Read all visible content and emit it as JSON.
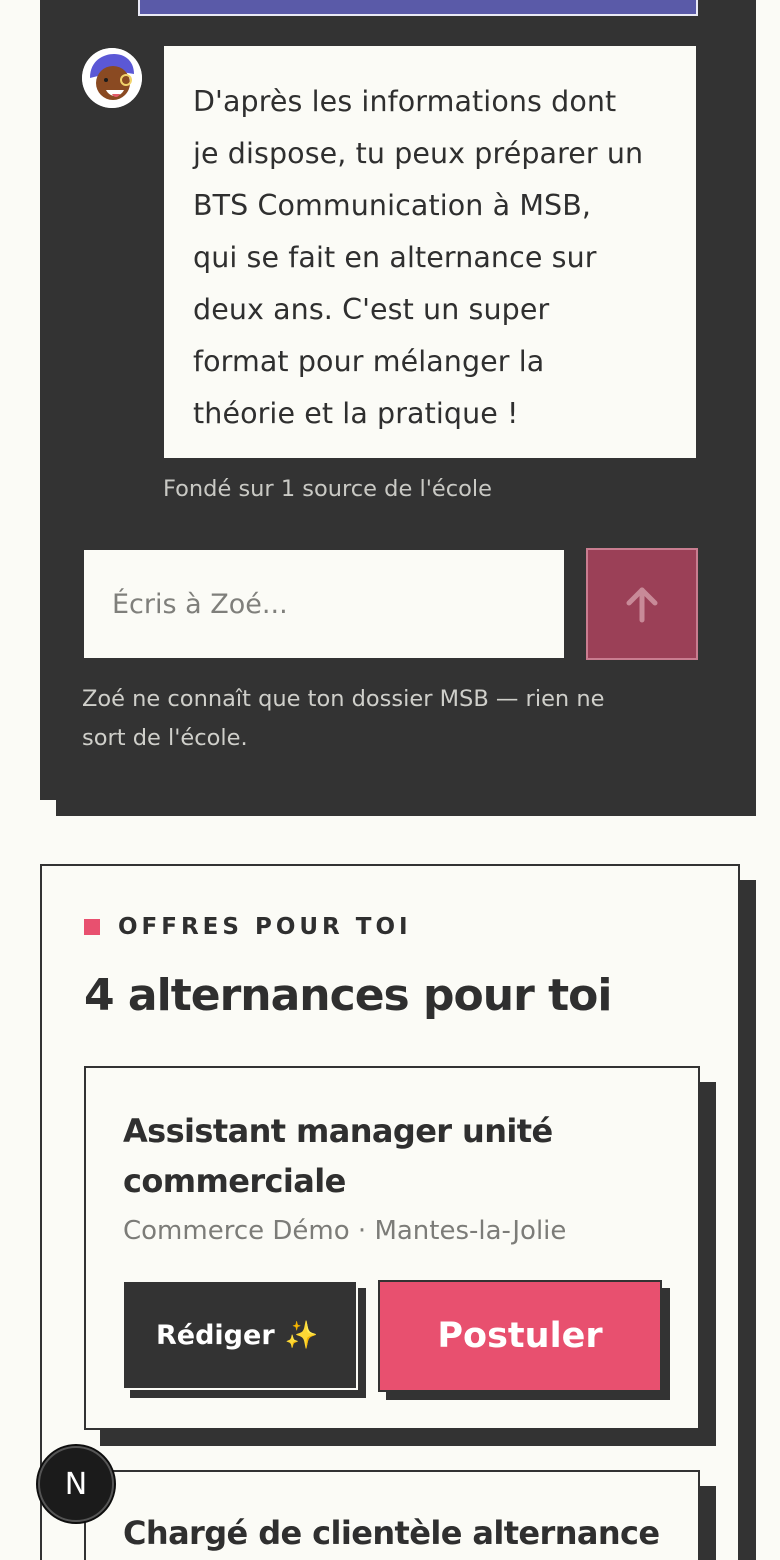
{
  "chat": {
    "bot_message": "D'après les informations dont je dispose, tu peux préparer un BTS Communication à MSB, qui se fait en alternance sur deux ans. C'est un super format pour mélanger la théorie et la pratique !",
    "bot_message_lines": [
      "D'après les informations dont",
      "je dispose, tu peux préparer un",
      "BTS Communication à MSB,",
      "qui se fait en alternance sur",
      "deux ans. C'est un super",
      "format pour mélanger la",
      "théorie et la pratique !"
    ],
    "source_note": "Fondé sur 1 source de l'école",
    "input_placeholder": "Écris à Zoé...",
    "send_icon": "arrow-up-icon",
    "privacy_note": "Zoé ne connaît que ton dossier MSB — rien ne sort de l'école.",
    "privacy_note_lines": [
      "Zoé ne connaît que ton dossier MSB — rien ne",
      "sort de l'école."
    ]
  },
  "offers": {
    "eyebrow": "OFFRES POUR TOI",
    "title": "4 alternances pour toi",
    "jobs": [
      {
        "title": "Assistant manager unité commerciale",
        "title_lines": [
          "Assistant manager unité",
          "commerciale"
        ],
        "company": "Commerce Démo",
        "separator": "·",
        "location": "Mantes-la-Jolie",
        "draft_label": "Rédiger",
        "draft_sparkle": "✨",
        "apply_label": "Postuler"
      },
      {
        "title": "Chargé de clientèle alternance"
      }
    ]
  },
  "badge": {
    "label": "N"
  },
  "colors": {
    "dark": "#333333",
    "accent_pink": "#e8506f",
    "send_button": "#9b4057",
    "background": "#fbfbf6"
  }
}
